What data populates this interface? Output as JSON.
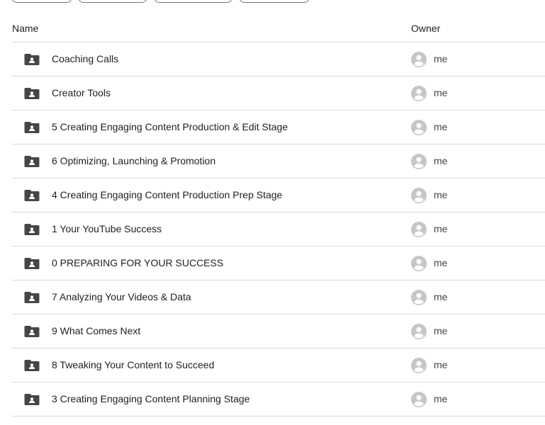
{
  "colors": {
    "folder_icon": "#444746",
    "avatar": "#c4c7c5",
    "divider": "#dadce0",
    "text": "#1f1f1f",
    "owner_text": "#444746"
  },
  "columns": {
    "name": "Name",
    "owner": "Owner"
  },
  "folders": [
    {
      "name": "Coaching Calls",
      "owner": "me",
      "icon": "shared-folder-icon"
    },
    {
      "name": "Creator Tools",
      "owner": "me",
      "icon": "shared-folder-icon"
    },
    {
      "name": "5 Creating Engaging Content Production & Edit Stage",
      "owner": "me",
      "icon": "shared-folder-icon"
    },
    {
      "name": "6 Optimizing, Launching & Promotion",
      "owner": "me",
      "icon": "shared-folder-icon"
    },
    {
      "name": "4 Creating Engaging Content Production Prep Stage",
      "owner": "me",
      "icon": "shared-folder-icon"
    },
    {
      "name": "1 Your YouTube Success",
      "owner": "me",
      "icon": "shared-folder-icon"
    },
    {
      "name": "0 PREPARING FOR YOUR SUCCESS",
      "owner": "me",
      "icon": "shared-folder-icon"
    },
    {
      "name": "7 Analyzing Your Videos & Data",
      "owner": "me",
      "icon": "shared-folder-icon"
    },
    {
      "name": "9 What Comes Next",
      "owner": "me",
      "icon": "shared-folder-icon"
    },
    {
      "name": "8 Tweaking Your Content to Succeed",
      "owner": "me",
      "icon": "shared-folder-icon"
    },
    {
      "name": "3 Creating Engaging Content Planning Stage",
      "owner": "me",
      "icon": "shared-folder-icon"
    }
  ]
}
